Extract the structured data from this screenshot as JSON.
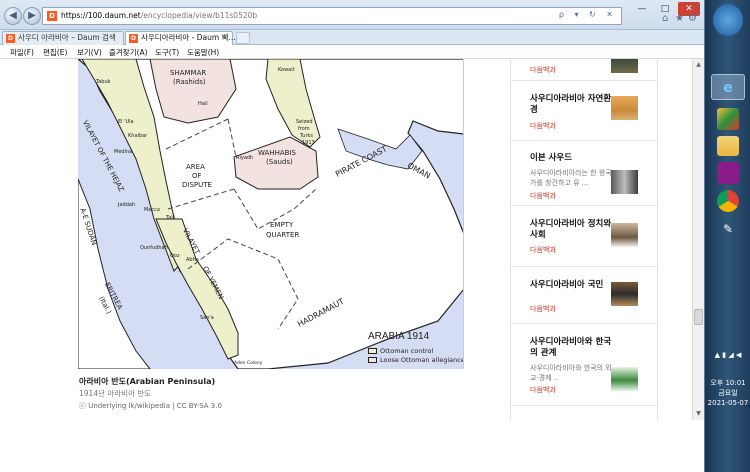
{
  "browser": {
    "url_host": "https://100.daum.net",
    "url_path": "/encyclopedia/view/b11s0520b",
    "address_tools": "ρ ▾ ↻ ✕",
    "favicon_letter": "D",
    "window_controls": {
      "minimize": "—",
      "maximize": "□",
      "close": "✕"
    },
    "toolbar_icons": {
      "home": "⌂",
      "favorites": "★",
      "settings": "⚙"
    },
    "back_glyph": "◀",
    "forward_glyph": "▶",
    "tabs": [
      {
        "label": "사우디 아라비아 – Daum 검색",
        "active": false
      },
      {
        "label": "사우디아라비아 - Daum 백...",
        "active": true,
        "close": "×"
      }
    ],
    "menu": [
      "파일(F)",
      "편집(E)",
      "보기(V)",
      "즐겨찾기(A)",
      "도구(T)",
      "도움말(H)"
    ]
  },
  "map": {
    "regions": [
      "SHAMMAR",
      "(Rashids)",
      "Kowait",
      "Hail",
      "VILAYET OF THE HEJAZ",
      "Tabuk",
      "El 'Ula",
      "Khaibar",
      "Medina",
      "AREA",
      "OF",
      "DISPUTE",
      "Seized",
      "from",
      "Turks",
      "1913",
      "WAHHABIS",
      "(Sauds)",
      "Riyadh",
      "PIRATE COAST",
      "OMAN",
      "Jeddah",
      "Mecca",
      "Taif",
      "A-E SUDAN",
      "EMPTY",
      "QUARTER",
      "Qunfudhah",
      "Qoz",
      "Abha",
      "VILAYET",
      "OF YEMEN",
      "ERITREA",
      "(Ital.)",
      "HADRAMAUT",
      "San'a",
      "Aden Colony"
    ],
    "map_title": "ARABIA 1914",
    "legend": [
      {
        "label": "Ottoman control",
        "color": "#eef0cc"
      },
      {
        "label": "Loose Ottoman allegiance",
        "color": "#f3e3e0"
      }
    ]
  },
  "caption": {
    "title": "아라비아 반도(Arabian Peninsula)",
    "subtitle": "1914년 아라비아 반도",
    "license": "ⓒ Underlying lk/wikipedia | CC BY-SA 3.0"
  },
  "sidebar": {
    "cards": [
      {
        "title": "",
        "desc": "",
        "source": "다음백과"
      },
      {
        "title": "사우디아라비아 자연환경",
        "desc": "",
        "source": "다음백과"
      },
      {
        "title": "이븐 사우드",
        "desc": "사우디아라비아라는 한 왕국가를 창건하고 유 ...",
        "source": "다음백과"
      },
      {
        "title": "사우디아라비아 정치와 사회",
        "desc": "",
        "source": "다음백과"
      },
      {
        "title": "사우디아라비아 국민",
        "desc": "",
        "source": "다음백과"
      },
      {
        "title": "사우디아라비아와 한국의 관계",
        "desc": "사우디아라비아와 한국의 외교·경제 ..",
        "source": "다음백과"
      }
    ]
  },
  "scrollbar": {
    "up": "▲",
    "down": "▼"
  },
  "taskbar": {
    "time_line1": "오후 10:01",
    "time_line2": "금요일",
    "date": "2021-05-07",
    "tray_icons": "▲ ▮ ◢ ◀"
  }
}
